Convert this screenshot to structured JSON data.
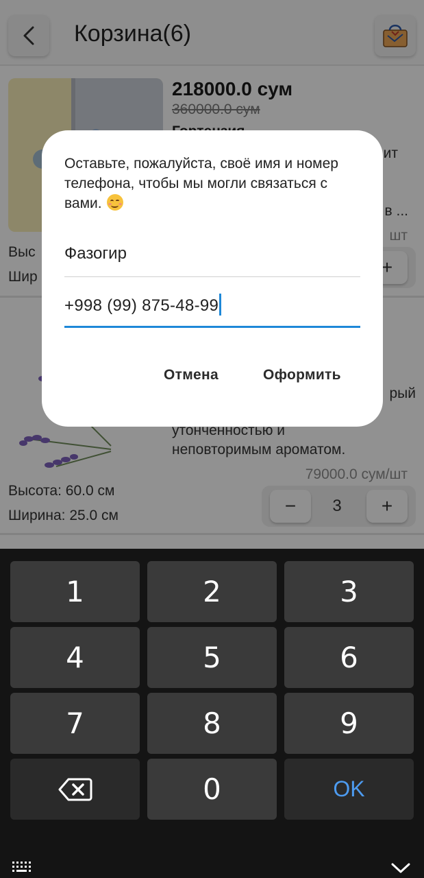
{
  "header": {
    "title": "Корзина(6)"
  },
  "cart": {
    "items": [
      {
        "price": "218000.0 сум",
        "old_price": "360000.0 сум",
        "name": "Гортензия",
        "desc_line1": "ит",
        "desc_line2": "в ...",
        "unit_price": "шт",
        "height": "Выс",
        "width": "Шир"
      },
      {
        "desc_line1": "рый",
        "desc_line2": "утонченностью и",
        "desc_line3": "неповторимым ароматом.",
        "unit_price": "79000.0 сум/шт",
        "height": "Высота: 60.0 см",
        "width": "Ширина: 25.0 см",
        "qty": "3"
      }
    ]
  },
  "dialog": {
    "message": "Оставьте, пожалуйста, своё имя и номер телефона, чтобы мы могли связаться с вами.",
    "name_value": "Фазогир",
    "phone_value": "+998 (99) 875-48-99",
    "cancel_label": "Отмена",
    "submit_label": "Оформить"
  },
  "keyboard": {
    "keys": [
      "1",
      "2",
      "3",
      "4",
      "5",
      "6",
      "7",
      "8",
      "9",
      "0"
    ],
    "ok_label": "OK"
  },
  "icons": {
    "back": "chevron-left-icon",
    "bag": "shopping-bag-icon",
    "backspace": "backspace-icon",
    "keyboard_grid": "keyboard-grid-icon",
    "hide_keyboard": "chevron-down-icon"
  },
  "colors": {
    "accent": "#1e88d8",
    "ok_key": "#4d9bf0"
  }
}
